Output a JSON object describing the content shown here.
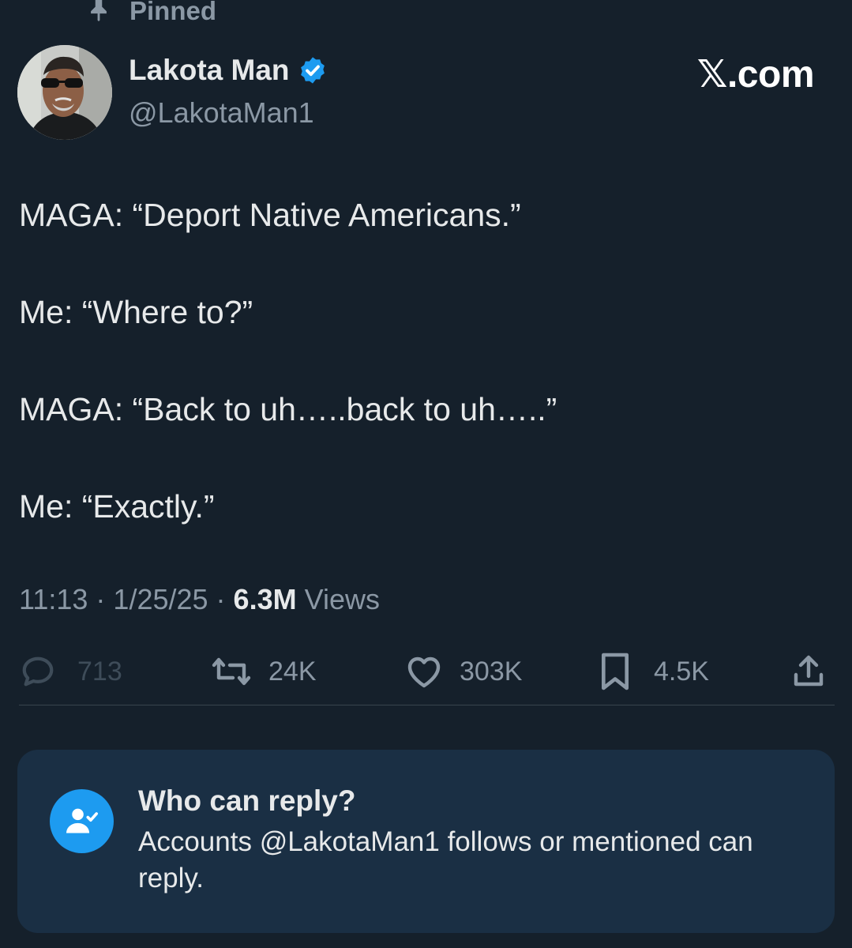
{
  "pinned_label": "Pinned",
  "author": {
    "display_name": "Lakota Man",
    "handle": "@LakotaMan1",
    "verified": true
  },
  "brand": "𝕏.com",
  "tweet": {
    "lines": [
      "MAGA: “Deport Native Americans.”",
      "Me: “Where to?”",
      "MAGA: “Back to uh…..back to uh…..”",
      "Me: “Exactly.”"
    ]
  },
  "meta": {
    "time": "11:13",
    "date": "1/25/25",
    "separator": "·",
    "views_count": "6.3M",
    "views_label": "Views"
  },
  "actions": {
    "replies": "713",
    "reposts": "24K",
    "likes": "303K",
    "bookmarks": "4.5K"
  },
  "reply_settings": {
    "title": "Who can reply?",
    "description": "Accounts @LakotaMan1 follows or mentioned can reply."
  },
  "colors": {
    "background": "#15202b",
    "card": "#1a2f44",
    "accent": "#1d9bf0",
    "muted": "#8b98a5"
  }
}
